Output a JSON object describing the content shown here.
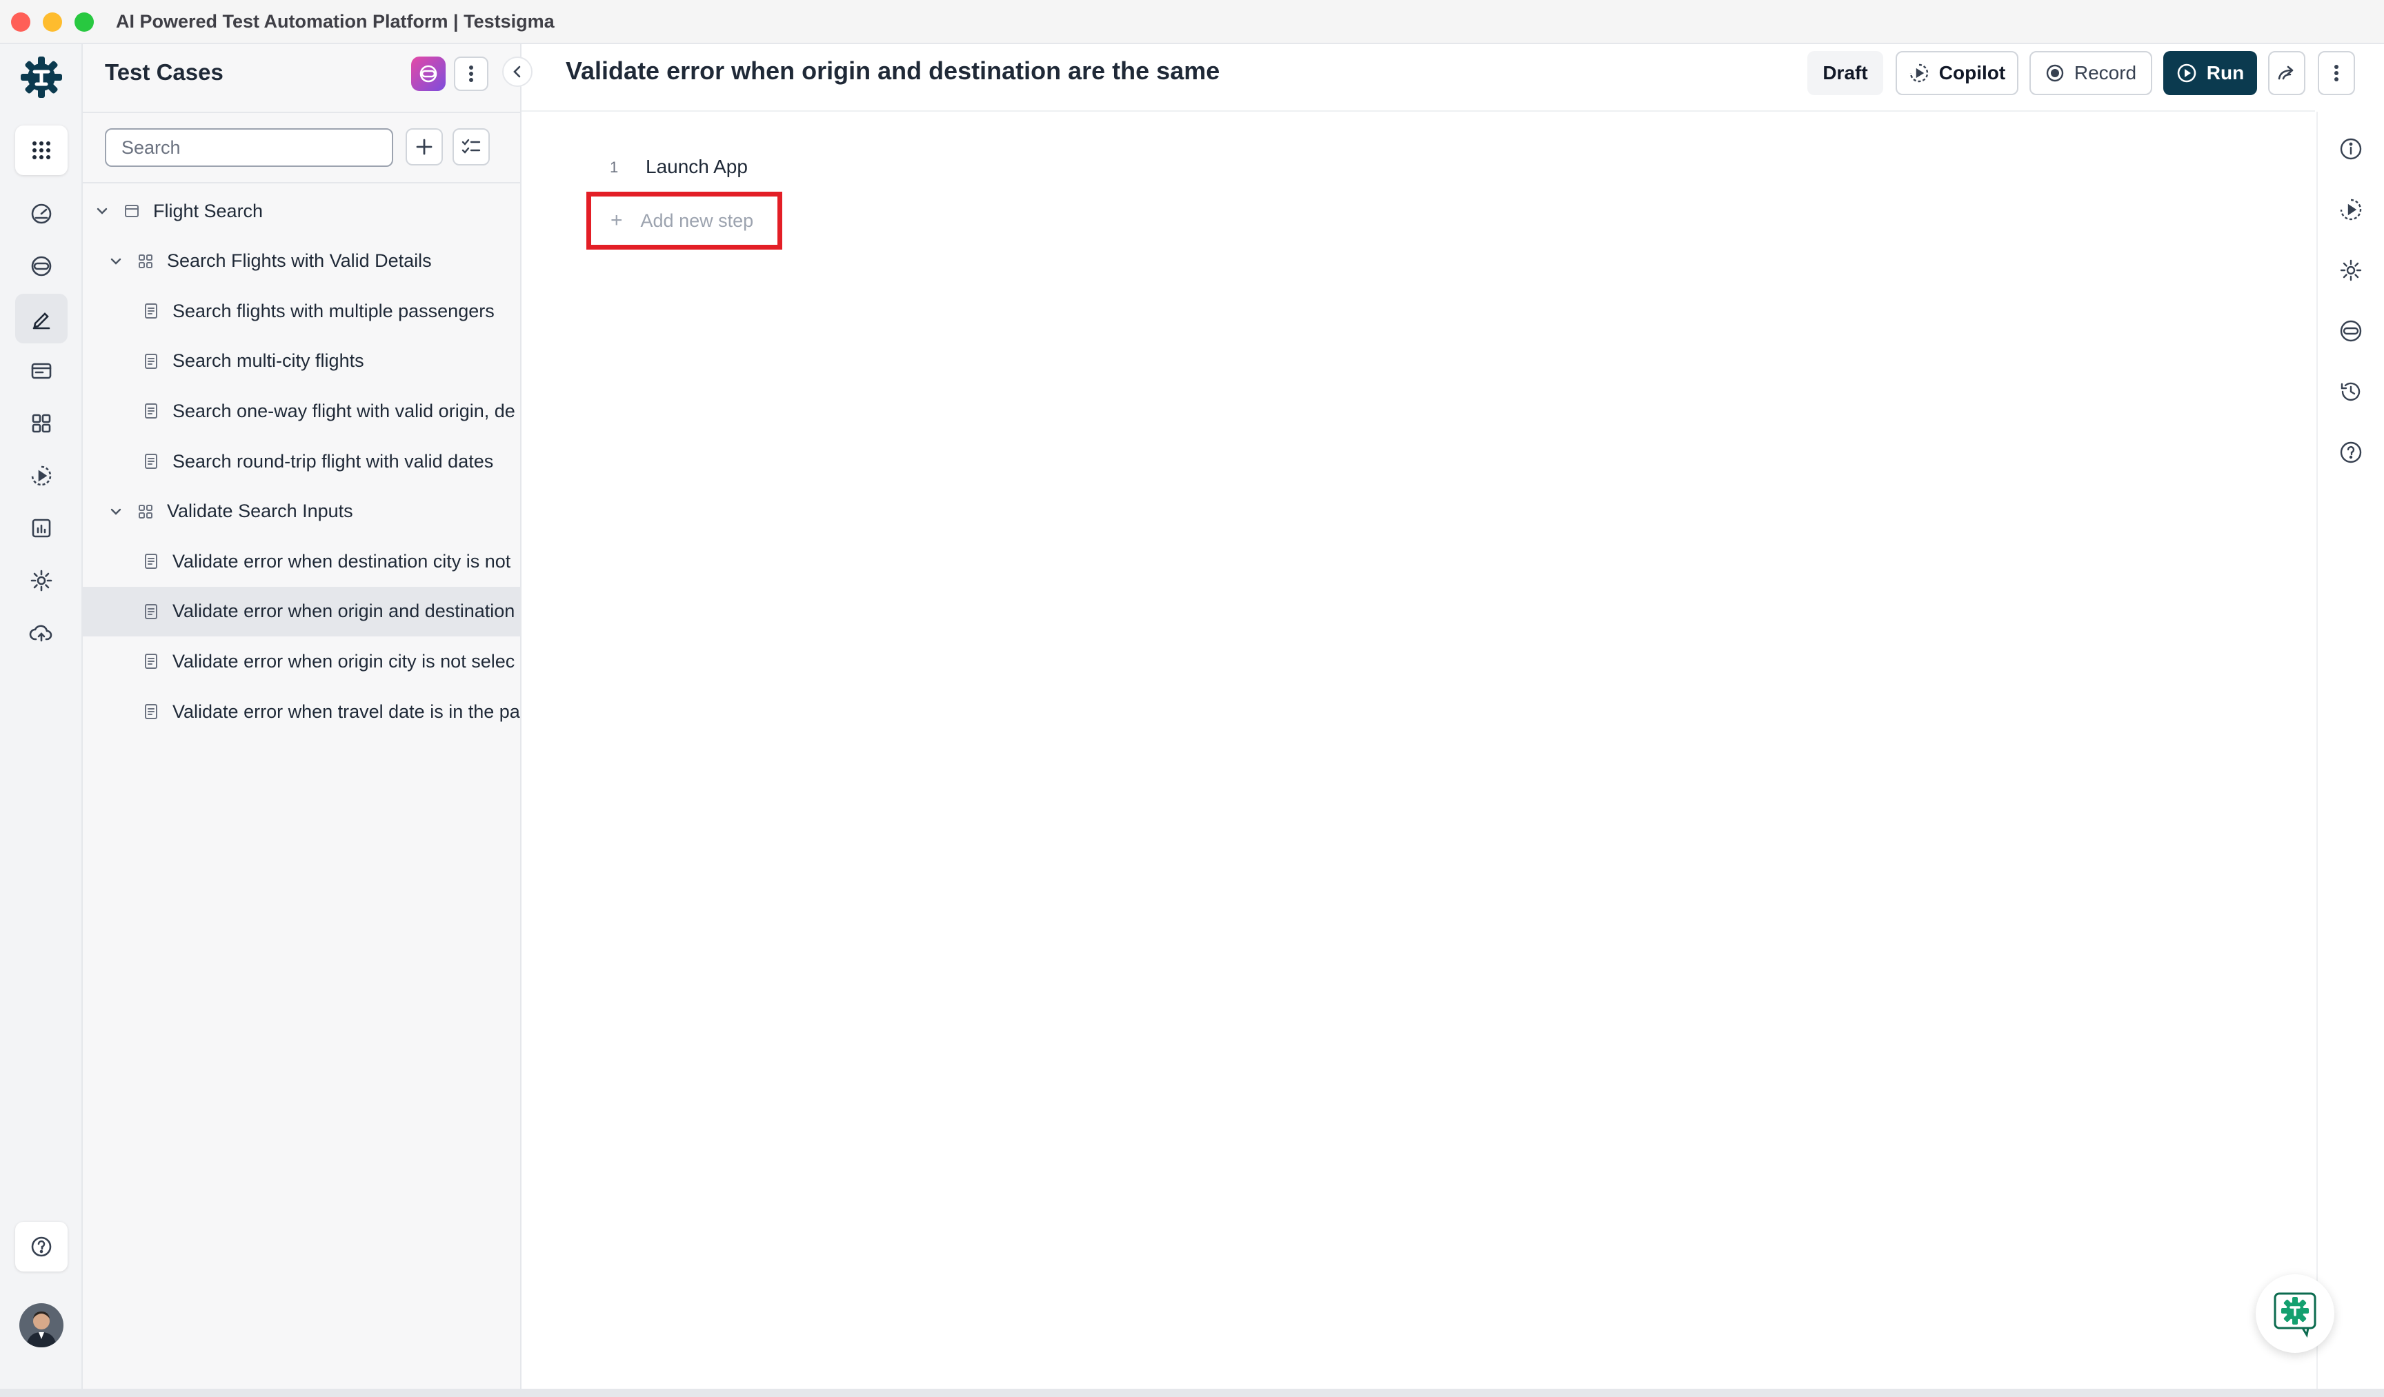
{
  "window": {
    "title": "AI Powered Test Automation Platform | Testsigma"
  },
  "rail": {
    "items": [
      {
        "icon": "apps-grid-icon"
      },
      {
        "icon": "dashboard-gauge-icon"
      },
      {
        "icon": "ai-agent-icon"
      },
      {
        "icon": "test-cases-pen-icon",
        "active": true
      },
      {
        "icon": "test-data-folder-icon"
      },
      {
        "icon": "elements-grid-icon"
      },
      {
        "icon": "runs-play-icon"
      },
      {
        "icon": "reports-chart-icon"
      },
      {
        "icon": "settings-gear-icon"
      },
      {
        "icon": "cloud-upload-icon"
      },
      {
        "icon": "help-icon"
      }
    ]
  },
  "panel": {
    "title": "Test Cases",
    "search_placeholder": "Search",
    "tree": [
      {
        "level": 0,
        "type": "folder",
        "label": "Flight Search",
        "expanded": true
      },
      {
        "level": 1,
        "type": "suite",
        "label": "Search Flights with Valid Details",
        "expanded": true
      },
      {
        "level": 2,
        "type": "case",
        "label": "Search flights with multiple passengers"
      },
      {
        "level": 2,
        "type": "case",
        "label": "Search multi-city flights"
      },
      {
        "level": 2,
        "type": "case",
        "label": "Search one-way flight with valid origin, de"
      },
      {
        "level": 2,
        "type": "case",
        "label": "Search round-trip flight with valid dates"
      },
      {
        "level": 1,
        "type": "suite",
        "label": "Validate Search Inputs",
        "expanded": true
      },
      {
        "level": 2,
        "type": "case",
        "label": "Validate error when destination city is not"
      },
      {
        "level": 2,
        "type": "case",
        "label": "Validate error when origin and destination",
        "selected": true
      },
      {
        "level": 2,
        "type": "case",
        "label": "Validate error when origin city is not selec"
      },
      {
        "level": 2,
        "type": "case",
        "label": "Validate error when travel date is in the pa"
      }
    ]
  },
  "main": {
    "title": "Validate error when origin and destination are the same",
    "buttons": {
      "draft": "Draft",
      "copilot": "Copilot",
      "record": "Record",
      "run": "Run"
    },
    "steps": [
      {
        "number": "1",
        "text": "Launch App"
      }
    ],
    "add_step_label": "Add new step"
  },
  "colors": {
    "run_button": "#0b3a4f",
    "highlight_box": "#e31e26",
    "brand": "#0b3a4f"
  }
}
